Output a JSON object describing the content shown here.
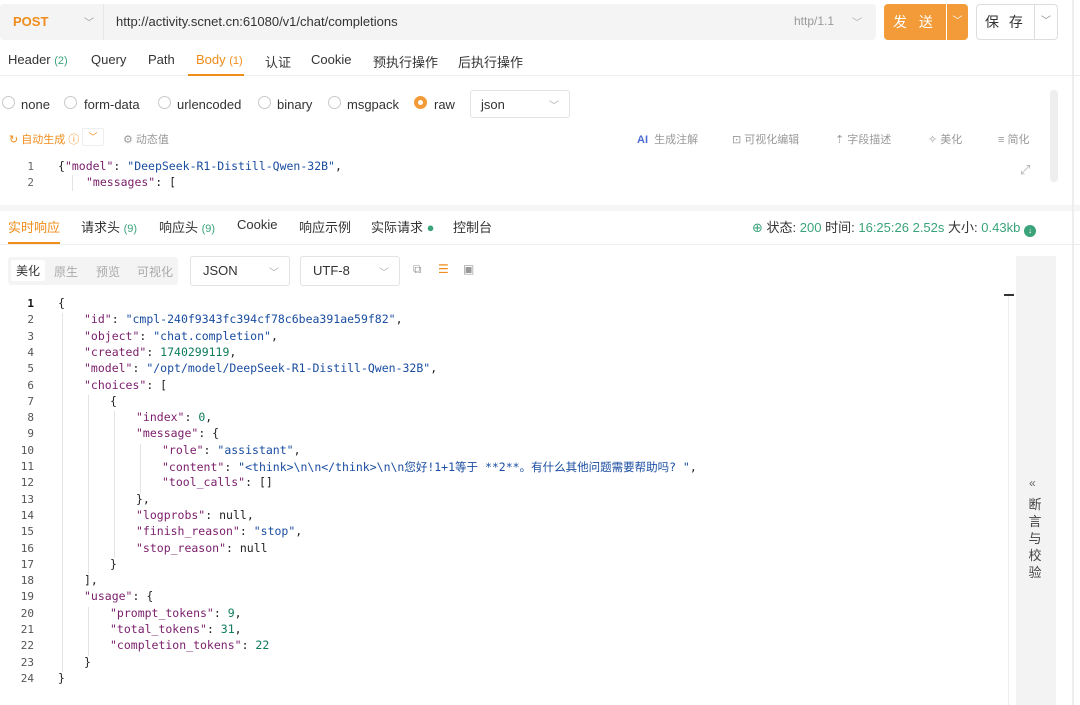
{
  "request": {
    "method": "POST",
    "url": "http://activity.scnet.cn:61080/v1/chat/completions",
    "http_version": "http/1.1",
    "send_label": "发 送",
    "save_label": "保 存"
  },
  "request_tabs": [
    {
      "label": "Header",
      "count": "(2)"
    },
    {
      "label": "Query",
      "count": ""
    },
    {
      "label": "Path",
      "count": ""
    },
    {
      "label": "Body",
      "count": "(1)"
    },
    {
      "label": "认证",
      "count": ""
    },
    {
      "label": "Cookie",
      "count": ""
    },
    {
      "label": "预执行操作",
      "count": ""
    },
    {
      "label": "后执行操作",
      "count": ""
    }
  ],
  "body_types": [
    "none",
    "form-data",
    "urlencoded",
    "binary",
    "msgpack",
    "raw"
  ],
  "body_format": "json",
  "toolbar": {
    "autogen": "自动生成",
    "dynamic": "动态值",
    "ai_label": "AI",
    "generate_comments": "生成注解",
    "visual_edit": "可视化编辑",
    "field_desc": "字段描述",
    "beautify": "美化",
    "simplify": "简化"
  },
  "request_body_lines": [
    {
      "no": "1",
      "key": "\"model\"",
      "value": "\"DeepSeek-R1-Distill-Qwen-32B\"",
      "prefix": "{",
      "suffix": ","
    },
    {
      "no": "2",
      "key": "\"messages\"",
      "value": "[",
      "prefix": "",
      "suffix": ""
    }
  ],
  "response_tabs": [
    {
      "label": "实时响应",
      "count": ""
    },
    {
      "label": "请求头",
      "count": "(9)"
    },
    {
      "label": "响应头",
      "count": "(9)"
    },
    {
      "label": "Cookie",
      "count": ""
    },
    {
      "label": "响应示例",
      "count": ""
    },
    {
      "label": "实际请求",
      "count": ""
    },
    {
      "label": "控制台",
      "count": ""
    }
  ],
  "status": {
    "status_label": "状态:",
    "status_code": "200",
    "time_label": "时间:",
    "time_value": "16:25:26",
    "duration": "2.52s",
    "size_label": "大小:",
    "size_value": "0.43kb"
  },
  "view_modes": [
    "美化",
    "原生",
    "预览",
    "可视化"
  ],
  "response_format": "JSON",
  "encoding": "UTF-8",
  "assert_label": "断言与校验",
  "colors": {
    "accent": "#f08c1a",
    "success": "#3aa37a",
    "key": "#7a1d6a",
    "string": "#1a4da0",
    "number": "#0d7a5b"
  },
  "response_lines": [
    {
      "no": "1",
      "indent": 0,
      "text": "{"
    },
    {
      "no": "2",
      "indent": 1,
      "key": "\"id\"",
      "value": "\"cmpl-240f9343fc394cf78c6bea391ae59f82\"",
      "type": "s",
      "suffix": ","
    },
    {
      "no": "3",
      "indent": 1,
      "key": "\"object\"",
      "value": "\"chat.completion\"",
      "type": "s",
      "suffix": ","
    },
    {
      "no": "4",
      "indent": 1,
      "key": "\"created\"",
      "value": "1740299119",
      "type": "n",
      "suffix": ","
    },
    {
      "no": "5",
      "indent": 1,
      "key": "\"model\"",
      "value": "\"/opt/model/DeepSeek-R1-Distill-Qwen-32B\"",
      "type": "s",
      "suffix": ","
    },
    {
      "no": "6",
      "indent": 1,
      "key": "\"choices\"",
      "value": "[",
      "type": "p",
      "suffix": ""
    },
    {
      "no": "7",
      "indent": 2,
      "text": "{"
    },
    {
      "no": "8",
      "indent": 3,
      "key": "\"index\"",
      "value": "0",
      "type": "n",
      "suffix": ","
    },
    {
      "no": "9",
      "indent": 3,
      "key": "\"message\"",
      "value": "{",
      "type": "p",
      "suffix": ""
    },
    {
      "no": "10",
      "indent": 4,
      "key": "\"role\"",
      "value": "\"assistant\"",
      "type": "s",
      "suffix": ","
    },
    {
      "no": "11",
      "indent": 4,
      "key": "\"content\"",
      "value": "\"<think>\\n\\n</think>\\n\\n您好!1+1等于 **2**。有什么其他问题需要帮助吗? \"",
      "type": "s",
      "suffix": ","
    },
    {
      "no": "12",
      "indent": 4,
      "key": "\"tool_calls\"",
      "value": "[]",
      "type": "p",
      "suffix": ""
    },
    {
      "no": "13",
      "indent": 3,
      "text": "},"
    },
    {
      "no": "14",
      "indent": 3,
      "key": "\"logprobs\"",
      "value": "null",
      "type": "p",
      "suffix": ","
    },
    {
      "no": "15",
      "indent": 3,
      "key": "\"finish_reason\"",
      "value": "\"stop\"",
      "type": "s",
      "suffix": ","
    },
    {
      "no": "16",
      "indent": 3,
      "key": "\"stop_reason\"",
      "value": "null",
      "type": "p",
      "suffix": ""
    },
    {
      "no": "17",
      "indent": 2,
      "text": "}"
    },
    {
      "no": "18",
      "indent": 1,
      "text": "],"
    },
    {
      "no": "19",
      "indent": 1,
      "key": "\"usage\"",
      "value": "{",
      "type": "p",
      "suffix": ""
    },
    {
      "no": "20",
      "indent": 2,
      "key": "\"prompt_tokens\"",
      "value": "9",
      "type": "n",
      "suffix": ","
    },
    {
      "no": "21",
      "indent": 2,
      "key": "\"total_tokens\"",
      "value": "31",
      "type": "n",
      "suffix": ","
    },
    {
      "no": "22",
      "indent": 2,
      "key": "\"completion_tokens\"",
      "value": "22",
      "type": "n",
      "suffix": ""
    },
    {
      "no": "23",
      "indent": 1,
      "text": "}"
    },
    {
      "no": "24",
      "indent": 0,
      "text": "}"
    }
  ]
}
